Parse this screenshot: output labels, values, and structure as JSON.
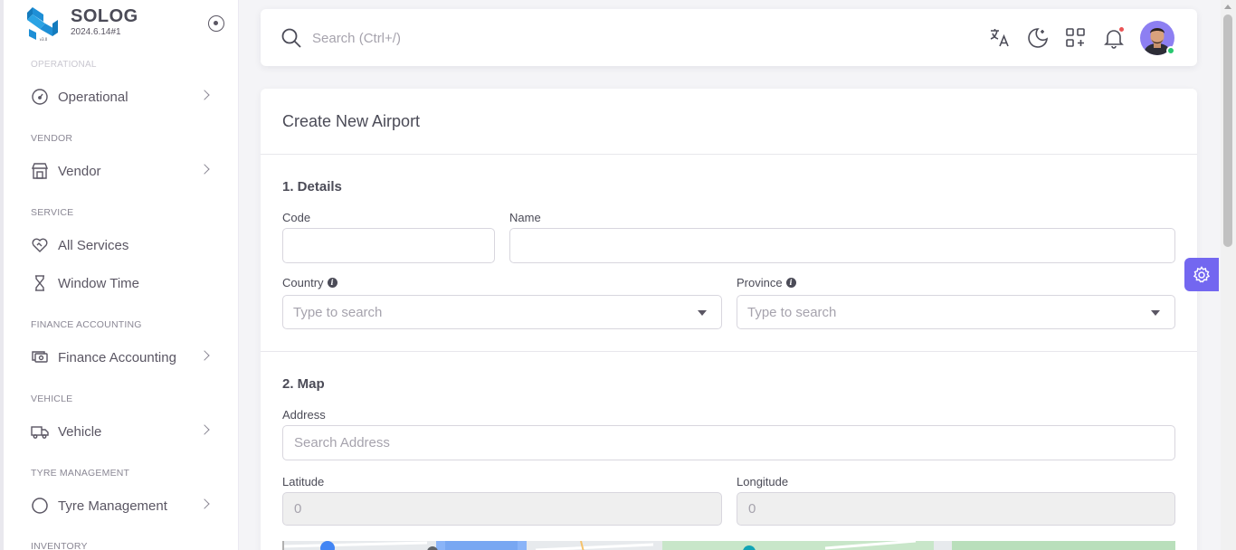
{
  "brand": {
    "name": "SOLOG",
    "version": "2024.6.14#1"
  },
  "sidebar": {
    "partial_top_label": "OPERATIONAL",
    "sections": [
      {
        "label": "",
        "items": [
          {
            "label": "Operational",
            "icon": "gauge-icon",
            "has_children": true
          }
        ]
      },
      {
        "label": "VENDOR",
        "items": [
          {
            "label": "Vendor",
            "icon": "store-icon",
            "has_children": true
          }
        ]
      },
      {
        "label": "SERVICE",
        "items": [
          {
            "label": "All Services",
            "icon": "heart-handshake-icon",
            "has_children": false
          },
          {
            "label": "Window Time",
            "icon": "hourglass-icon",
            "has_children": false
          }
        ]
      },
      {
        "label": "FINANCE ACCOUNTING",
        "items": [
          {
            "label": "Finance Accounting",
            "icon": "cash-icon",
            "has_children": true
          }
        ]
      },
      {
        "label": "VEHICLE",
        "items": [
          {
            "label": "Vehicle",
            "icon": "truck-icon",
            "has_children": true
          }
        ]
      },
      {
        "label": "TYRE MANAGEMENT",
        "items": [
          {
            "label": "Tyre Management",
            "icon": "circle-icon",
            "has_children": true
          }
        ]
      },
      {
        "label": "INVENTORY",
        "items": []
      }
    ]
  },
  "navbar": {
    "search_placeholder": "Search (Ctrl+/)",
    "tools": [
      "translate-icon",
      "moon-icon",
      "apps-add-icon",
      "bell-icon"
    ],
    "notification_dot": true
  },
  "form": {
    "title": "Create New Airport",
    "details": {
      "section_title": "1. Details",
      "code_label": "Code",
      "code_value": "",
      "name_label": "Name",
      "name_value": "",
      "country_label": "Country",
      "country_placeholder": "Type to search",
      "province_label": "Province",
      "province_placeholder": "Type to search"
    },
    "map": {
      "section_title": "2. Map",
      "address_label": "Address",
      "address_placeholder": "Search Address",
      "latitude_label": "Latitude",
      "latitude_value": "0",
      "longitude_label": "Longitude",
      "longitude_value": "0"
    }
  },
  "colors": {
    "primary": "#7367f0",
    "brand_blue": "#1e8fd6",
    "online": "#28c76f",
    "notification": "#ea5455"
  }
}
